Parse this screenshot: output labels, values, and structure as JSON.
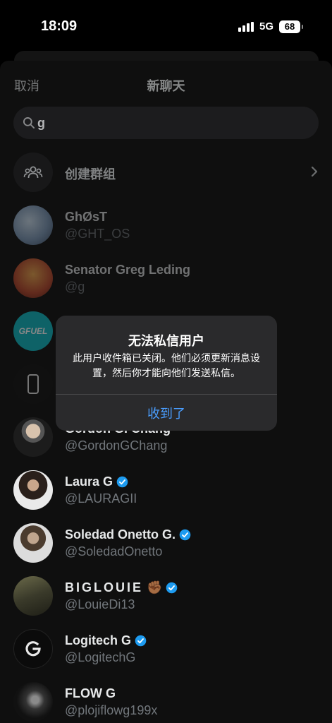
{
  "status_bar": {
    "time": "18:09",
    "network": "5G",
    "battery": "68"
  },
  "header": {
    "cancel_label": "取消",
    "title": "新聊天"
  },
  "search": {
    "value": "g"
  },
  "create_group": {
    "label": "创建群组"
  },
  "dialog": {
    "title": "无法私信用户",
    "message": "此用户收件箱已关闭。他们必须更新消息设置，然后你才能向他们发送私信。",
    "button_label": "收到了"
  },
  "contacts": [
    {
      "name": "GhØsT",
      "handle": "@GHT_OS",
      "verified": false
    },
    {
      "name": "Senator Greg Leding",
      "handle": "@g",
      "verified": false
    },
    {
      "name": "",
      "handle": "",
      "verified": false,
      "avatar_text": "GFUEL"
    },
    {
      "name": "",
      "handle": "",
      "verified": false
    },
    {
      "name": "Gordon G. Chang",
      "handle": "@GordonGChang",
      "verified": true
    },
    {
      "name": "Laura G",
      "handle": "@LAURAGII",
      "verified": true
    },
    {
      "name": "Soledad Onetto G.",
      "handle": "@SoledadOnetto",
      "verified": true
    },
    {
      "name": "BIGLOUIE",
      "handle": "@LouieDi13",
      "verified": true
    },
    {
      "name": "Logitech G",
      "handle": "@LogitechG",
      "verified": true
    },
    {
      "name": "FLOW G",
      "handle": "@plojiflowg199x",
      "verified": false
    }
  ],
  "colors": {
    "accent": "#4a9eff",
    "verified": "#1d9bf0",
    "background": "#000000"
  }
}
